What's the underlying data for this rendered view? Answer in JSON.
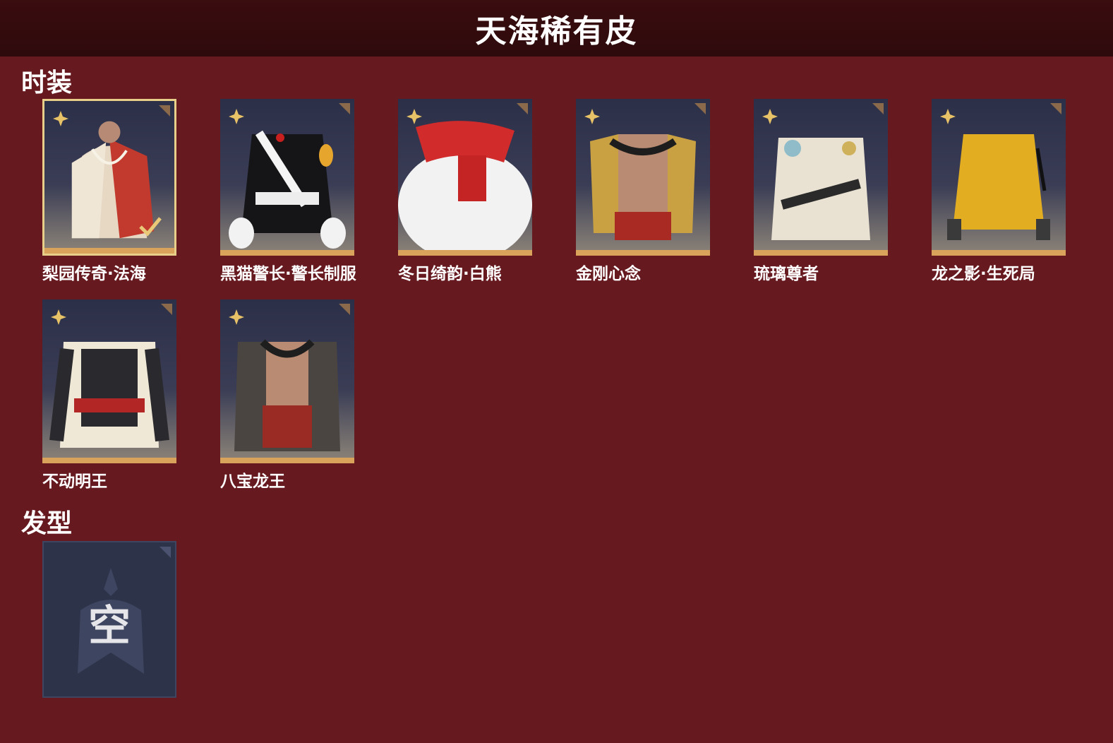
{
  "header": {
    "title": "天海稀有皮"
  },
  "sections": {
    "costume": {
      "title": "时装"
    },
    "hair": {
      "title": "发型",
      "empty_label": "空"
    }
  },
  "costumes": [
    {
      "name": "梨园传奇·法海",
      "selected": true
    },
    {
      "name": "黑猫警长·警长制服",
      "selected": false
    },
    {
      "name": "冬日绮韵·白熊",
      "selected": false
    },
    {
      "name": "金刚心念",
      "selected": false
    },
    {
      "name": "琉璃尊者",
      "selected": false
    },
    {
      "name": "龙之影·生死局",
      "selected": false
    },
    {
      "name": "不动明王",
      "selected": false
    },
    {
      "name": "八宝龙王",
      "selected": false
    }
  ],
  "colors": {
    "background": "#661a1f",
    "header": "#2e0a0c",
    "card_gold": "#d9a35c",
    "selected_border": "#e7cf8a"
  }
}
